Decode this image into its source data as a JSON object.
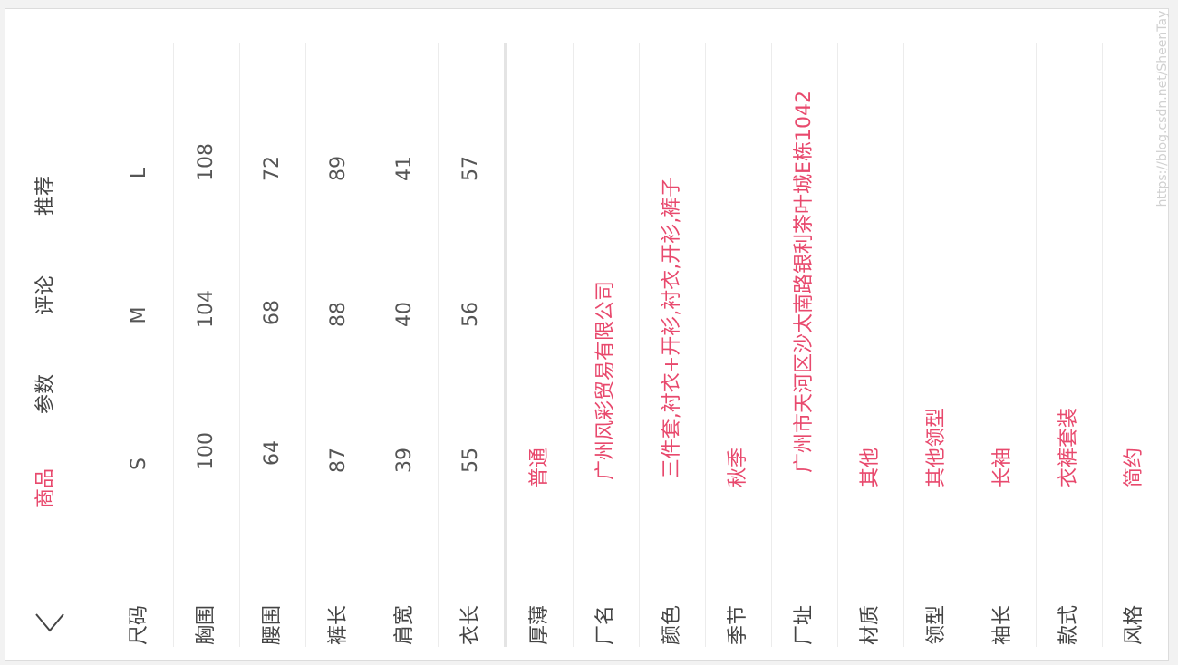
{
  "tabs": [
    {
      "label": "商品",
      "active": true
    },
    {
      "label": "参数",
      "active": false
    },
    {
      "label": "评论",
      "active": false
    },
    {
      "label": "推荐",
      "active": false
    }
  ],
  "size_table": {
    "rows": [
      {
        "label": "尺码",
        "values": [
          "S",
          "M",
          "L"
        ]
      },
      {
        "label": "胸围",
        "values": [
          "100",
          "104",
          "108"
        ]
      },
      {
        "label": "腰围",
        "values": [
          "64",
          "68",
          "72"
        ]
      },
      {
        "label": "裤长",
        "values": [
          "87",
          "88",
          "89"
        ]
      },
      {
        "label": "肩宽",
        "values": [
          "39",
          "40",
          "41"
        ]
      },
      {
        "label": "衣长",
        "values": [
          "55",
          "56",
          "57"
        ]
      }
    ]
  },
  "attributes": [
    {
      "label": "厚薄",
      "value": "普通"
    },
    {
      "label": "厂名",
      "value": "广州风彩贸易有限公司"
    },
    {
      "label": "颜色",
      "value": "三件套,衬衣+开衫,衬衣,开衫,裤子"
    },
    {
      "label": "季节",
      "value": "秋季"
    },
    {
      "label": "厂址",
      "value": "广州市天河区沙太南路银利茶叶城E栋1042"
    },
    {
      "label": "材质",
      "value": "其他"
    },
    {
      "label": "领型",
      "value": "其他领型"
    },
    {
      "label": "袖长",
      "value": "长袖"
    },
    {
      "label": "款式",
      "value": "衣裤套装"
    },
    {
      "label": "风格",
      "value": "简约"
    }
  ],
  "icons": {
    "back": "chevron-down-icon"
  },
  "watermark": "https://blog.csdn.net/SheenTay",
  "colors": {
    "accent": "#e8496d",
    "text": "#444444",
    "divider": "#ececec"
  }
}
